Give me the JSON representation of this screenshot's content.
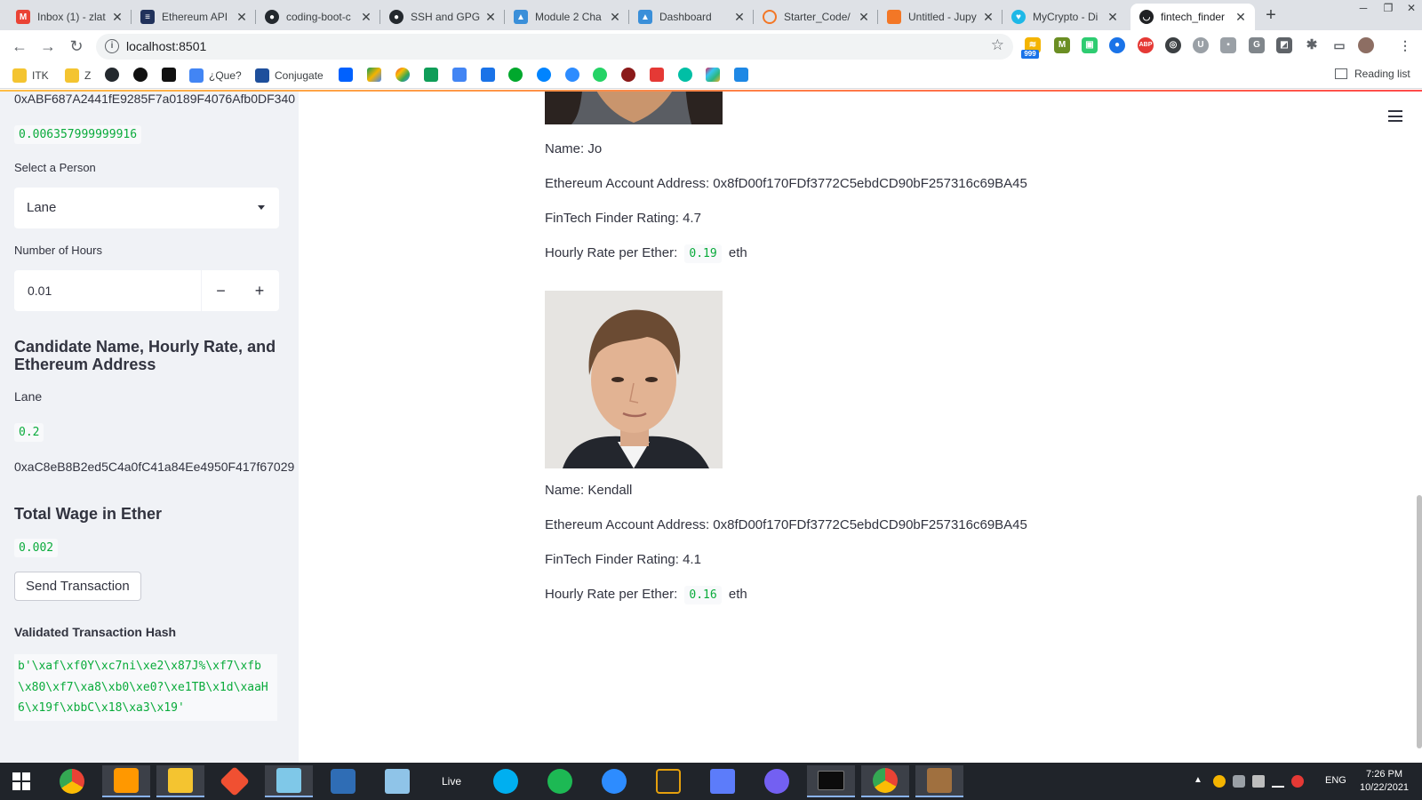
{
  "browser": {
    "tabs": [
      {
        "label": "Inbox (1) - zlat",
        "icon": "gmail-icon",
        "color": "#ea4335"
      },
      {
        "label": "Ethereum API |",
        "icon": "etherscan-icon",
        "color": "#21325b"
      },
      {
        "label": "coding-boot-c",
        "icon": "github-icon",
        "color": "#24292e"
      },
      {
        "label": "SSH and GPG",
        "icon": "github-icon",
        "color": "#24292e"
      },
      {
        "label": "Module 2 Cha",
        "icon": "canvas-icon",
        "color": "#3a8fd9"
      },
      {
        "label": "Dashboard",
        "icon": "canvas-icon",
        "color": "#3a8fd9"
      },
      {
        "label": "Starter_Code/",
        "icon": "jupyter-icon",
        "color": "#f37726"
      },
      {
        "label": "Untitled - Jupy",
        "icon": "jupyter-icon",
        "color": "#f37726"
      },
      {
        "label": "MyCrypto - Di",
        "icon": "mycrypto-icon",
        "color": "#1eb8e7"
      },
      {
        "label": "fintech_finder",
        "icon": "streamlit-icon",
        "color": "#202124"
      }
    ],
    "address": "localhost:8501",
    "bookmarks": [
      {
        "label": "ITK",
        "icon": "folder-icon"
      },
      {
        "label": "Z",
        "icon": "folder-icon"
      },
      {
        "label": "¿Que?",
        "icon": "translate-icon"
      },
      {
        "label": "Conjugate",
        "icon": "conjugate-icon"
      }
    ],
    "reading_list": "Reading list",
    "extension_badge": "999"
  },
  "sidebar": {
    "account_address": "0xABF687A2441fE9285F7a0189F4076Afb0DF340",
    "balance": "0.006357999999916",
    "select_person_label": "Select a Person",
    "selected_person": "Lane",
    "hours_label": "Number of Hours",
    "hours_value": "0.01",
    "candidate_heading": "Candidate Name, Hourly Rate, and Ethereum Address",
    "candidate_name": "Lane",
    "candidate_rate": "0.2",
    "candidate_address": "0xaC8eB8B2ed5C4a0fC41a84Ee4950F417f67029",
    "wage_heading": "Total Wage in Ether",
    "wage_value": "0.002",
    "send_button": "Send Transaction",
    "hash_label": "Validated Transaction Hash",
    "hash_value": "b'\\xaf\\xf0Y\\xc7ni\\xe2\\x87J%\\xf7\\xfb\\x80\\xf7\\xa8\\xb0\\xe0?\\xe1TB\\x1d\\xaaH6\\x19f\\xbbC\\x18\\xa3\\x19'"
  },
  "main": {
    "candidates": [
      {
        "name_line": "Name: Jo",
        "address_line": "Ethereum Account Address: 0x8fD00f170FDf3772C5ebdCD90bF257316c69BA45",
        "rating_line": "FinTech Finder Rating: 4.7",
        "rate_label": "Hourly Rate per Ether:",
        "rate_value": "0.19",
        "rate_unit": "eth"
      },
      {
        "name_line": "Name: Kendall",
        "address_line": "Ethereum Account Address: 0x8fD00f170FDf3772C5ebdCD90bF257316c69BA45",
        "rating_line": "FinTech Finder Rating: 4.1",
        "rate_label": "Hourly Rate per Ether:",
        "rate_value": "0.16",
        "rate_unit": "eth"
      }
    ]
  },
  "taskbar": {
    "apps": [
      "start-icon",
      "chrome-icon",
      "sublime-icon",
      "explorer-icon",
      "git-icon",
      "notepad-icon",
      "virtualbox-icon",
      "snipping-icon",
      "live-icon",
      "skype-icon",
      "spotify-icon",
      "zoom-icon",
      "plex-icon",
      "remote-icon",
      "viber-icon",
      "terminal-icon",
      "chrome-icon",
      "minecraft-icon"
    ],
    "live_label": "Live",
    "language": "ENG",
    "time": "7:26 PM",
    "date": "10/22/2021"
  }
}
